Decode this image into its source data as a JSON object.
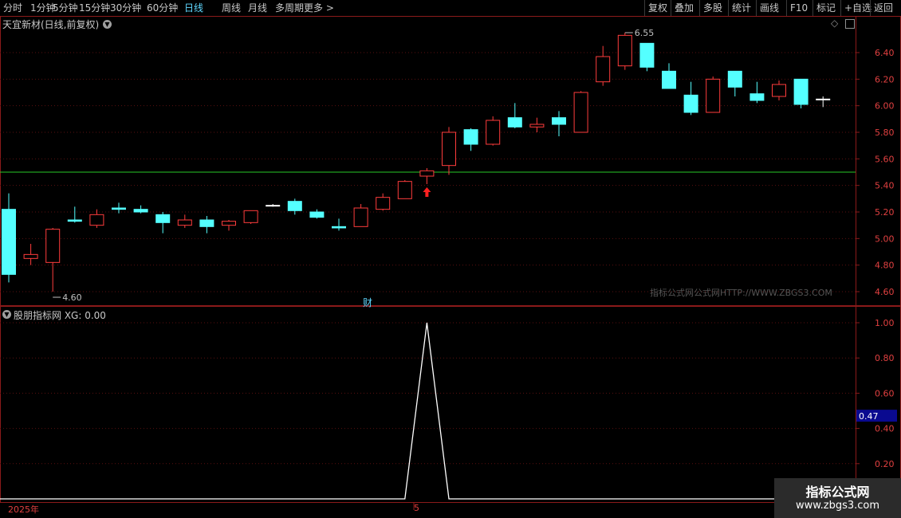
{
  "toolbar": {
    "left": [
      "分时",
      "1分钟",
      "5分钟",
      "15分钟",
      "30分钟",
      "60分钟",
      "日线",
      "周线",
      "月线",
      "多周期",
      "更多 >"
    ],
    "active_index": 6,
    "right": [
      "复权",
      "叠加",
      "多股",
      "统计",
      "画线",
      "F10",
      "标记",
      "+自选",
      "返回"
    ]
  },
  "main_panel": {
    "title": "天宜新材(日线,前复权)",
    "high_label": "6.55",
    "low_label": "4.60",
    "event_label": "财",
    "watermark": "指标公式网公式网HTTP://WWW.ZBGS3.COM",
    "y_ticks": [
      "6.40",
      "6.20",
      "6.00",
      "5.80",
      "5.60",
      "5.40",
      "5.20",
      "5.00",
      "4.80",
      "4.60"
    ]
  },
  "indicator_panel": {
    "title": "股朋指标网 XG: 0.00",
    "y_ticks": [
      "1.00",
      "0.80",
      "0.60",
      "0.40",
      "0.20"
    ],
    "cursor_value": "0.47"
  },
  "x_axis": {
    "year_label": "2025年",
    "month_label": "5"
  },
  "brand": {
    "name": "指标公式网",
    "url": "www.zbgs3.com"
  },
  "colors": {
    "up": "#ff3c3c",
    "down": "#54ffff",
    "flat": "#ffffff",
    "support_line": "#28c828",
    "indicator_line": "#ffffff",
    "grid": "#5a1010",
    "frame": "#8b1a1a"
  },
  "chart_data": [
    {
      "type": "candlestick",
      "title": "天宜新材(日线,前复权)",
      "ylim": [
        4.55,
        6.6
      ],
      "support_line": 5.5,
      "candles": [
        {
          "o": 5.22,
          "h": 5.34,
          "l": 4.67,
          "c": 4.73
        },
        {
          "o": 4.85,
          "h": 4.96,
          "l": 4.8,
          "c": 4.88
        },
        {
          "o": 4.82,
          "h": 5.08,
          "l": 4.6,
          "c": 5.07
        },
        {
          "o": 5.14,
          "h": 5.24,
          "l": 5.12,
          "c": 5.13
        },
        {
          "o": 5.1,
          "h": 5.22,
          "l": 5.08,
          "c": 5.18
        },
        {
          "o": 5.23,
          "h": 5.27,
          "l": 5.19,
          "c": 5.22
        },
        {
          "o": 5.22,
          "h": 5.25,
          "l": 5.19,
          "c": 5.2
        },
        {
          "o": 5.18,
          "h": 5.2,
          "l": 5.04,
          "c": 5.12
        },
        {
          "o": 5.1,
          "h": 5.18,
          "l": 5.08,
          "c": 5.14
        },
        {
          "o": 5.14,
          "h": 5.17,
          "l": 5.04,
          "c": 5.09
        },
        {
          "o": 5.1,
          "h": 5.14,
          "l": 5.06,
          "c": 5.13
        },
        {
          "o": 5.12,
          "h": 5.21,
          "l": 5.11,
          "c": 5.21
        },
        {
          "o": 5.25,
          "h": 5.26,
          "l": 5.24,
          "c": 5.25
        },
        {
          "o": 5.28,
          "h": 5.3,
          "l": 5.18,
          "c": 5.21
        },
        {
          "o": 5.2,
          "h": 5.22,
          "l": 5.15,
          "c": 5.16
        },
        {
          "o": 5.09,
          "h": 5.15,
          "l": 5.06,
          "c": 5.08
        },
        {
          "o": 5.09,
          "h": 5.26,
          "l": 5.09,
          "c": 5.23
        },
        {
          "o": 5.22,
          "h": 5.34,
          "l": 5.21,
          "c": 5.31
        },
        {
          "o": 5.3,
          "h": 5.44,
          "l": 5.3,
          "c": 5.43
        },
        {
          "o": 5.47,
          "h": 5.53,
          "l": 5.41,
          "c": 5.51
        },
        {
          "o": 5.55,
          "h": 5.84,
          "l": 5.48,
          "c": 5.8
        },
        {
          "o": 5.82,
          "h": 5.83,
          "l": 5.66,
          "c": 5.71
        },
        {
          "o": 5.71,
          "h": 5.92,
          "l": 5.7,
          "c": 5.89
        },
        {
          "o": 5.91,
          "h": 6.02,
          "l": 5.83,
          "c": 5.84
        },
        {
          "o": 5.84,
          "h": 5.91,
          "l": 5.8,
          "c": 5.86
        },
        {
          "o": 5.91,
          "h": 5.96,
          "l": 5.77,
          "c": 5.86
        },
        {
          "o": 5.8,
          "h": 6.11,
          "l": 5.8,
          "c": 6.1
        },
        {
          "o": 6.18,
          "h": 6.45,
          "l": 6.15,
          "c": 6.37
        },
        {
          "o": 6.3,
          "h": 6.55,
          "l": 6.27,
          "c": 6.53
        },
        {
          "o": 6.47,
          "h": 6.47,
          "l": 6.26,
          "c": 6.29
        },
        {
          "o": 6.26,
          "h": 6.32,
          "l": 6.13,
          "c": 6.13
        },
        {
          "o": 6.08,
          "h": 6.18,
          "l": 5.93,
          "c": 5.95
        },
        {
          "o": 5.95,
          "h": 6.22,
          "l": 5.95,
          "c": 6.2
        },
        {
          "o": 6.26,
          "h": 6.26,
          "l": 6.07,
          "c": 6.14
        },
        {
          "o": 6.09,
          "h": 6.18,
          "l": 6.02,
          "c": 6.04
        },
        {
          "o": 6.07,
          "h": 6.19,
          "l": 6.04,
          "c": 6.16
        },
        {
          "o": 6.2,
          "h": 6.2,
          "l": 5.98,
          "c": 6.01
        },
        {
          "o": 6.05,
          "h": 6.07,
          "l": 5.99,
          "c": 6.05
        }
      ]
    },
    {
      "type": "line",
      "title": "股朋指标网 XG: 0.00",
      "ylim": [
        0,
        1
      ],
      "series": [
        {
          "name": "XG",
          "values": [
            0,
            0,
            0,
            0,
            0,
            0,
            0,
            0,
            0,
            0,
            0,
            0,
            0,
            0,
            0,
            0,
            0,
            0,
            0,
            1,
            0,
            0,
            0,
            0,
            0,
            0,
            0,
            0,
            0,
            0,
            0,
            0,
            0,
            0,
            0,
            0,
            0,
            0
          ]
        }
      ]
    }
  ]
}
